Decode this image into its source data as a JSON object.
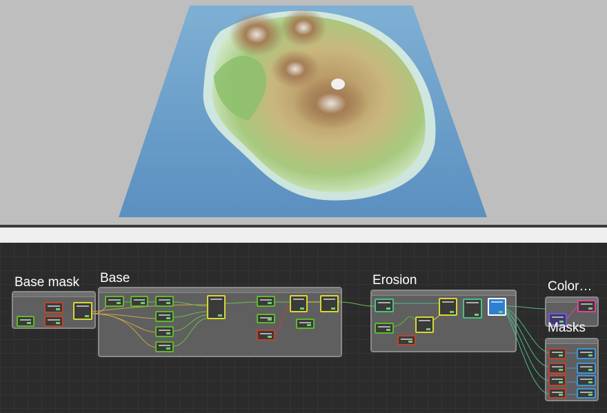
{
  "viewport": {
    "background": "#bebebe",
    "terrain": {
      "water_color": "#6a9cc8",
      "lowland_color": "#8fbf6a",
      "highland_color": "#a8885a",
      "peak_color": "#d8d0c8"
    }
  },
  "graph": {
    "background": "#2b2b2b",
    "groups": [
      {
        "id": "base-mask",
        "title": "Base mask"
      },
      {
        "id": "base",
        "title": "Base"
      },
      {
        "id": "erosion",
        "title": "Erosion"
      },
      {
        "id": "color",
        "title": "Color…"
      },
      {
        "id": "masks",
        "title": "Masks"
      }
    ]
  },
  "colors": {
    "generator": "#5dbb2c",
    "filter": "#c0452e",
    "combine": "#d9d733",
    "erosion": "#4cbf86",
    "output": "#3f97d8",
    "color": "#7a55e0",
    "selected": "#ffffff"
  }
}
